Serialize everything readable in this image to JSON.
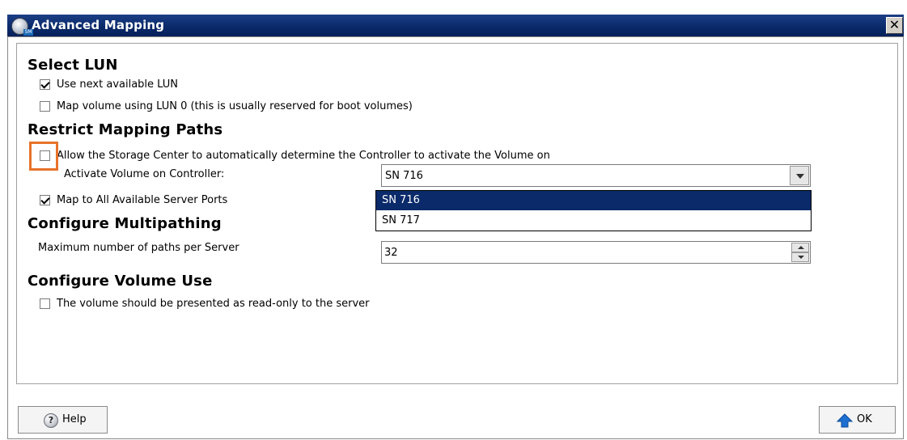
{
  "window": {
    "title": "Advanced Mapping",
    "close_glyph": "✕",
    "app_icon": "dell-storage-manager-icon",
    "app_icon_sub": "SM"
  },
  "sections": {
    "select_lun": {
      "title": "Select LUN",
      "use_next_available": {
        "label": "Use next available LUN",
        "checked": true
      },
      "map_lun0": {
        "label": "Map volume using LUN 0 (this is usually reserved for boot volumes)",
        "checked": false
      }
    },
    "restrict_paths": {
      "title": "Restrict Mapping Paths",
      "auto_controller": {
        "label": "Allow the Storage Center to automatically determine the Controller to activate the Volume on",
        "checked": false
      },
      "activate_label": "Activate Volume on Controller:",
      "controller_select": {
        "value": "SN 716",
        "options": [
          "SN 716",
          "SN 717"
        ],
        "highlighted_option": "SN 716"
      },
      "map_all_ports": {
        "label": "Map to All Available Server Ports",
        "checked": true
      }
    },
    "multipathing": {
      "title": "Configure Multipathing",
      "max_paths_label": "Maximum number of paths per Server",
      "max_paths_value": "32"
    },
    "volume_use": {
      "title": "Configure Volume Use",
      "read_only": {
        "label": "The volume should be presented as read-only to the server",
        "checked": false
      }
    }
  },
  "buttons": {
    "help": {
      "label": "Help",
      "icon": "help-icon"
    },
    "ok": {
      "label": "OK",
      "icon": "up-arrow-icon"
    }
  },
  "colors": {
    "titlebar": "#0a2a6a",
    "selection": "#0a2a6a",
    "highlight_annotation": "#e8722a"
  }
}
